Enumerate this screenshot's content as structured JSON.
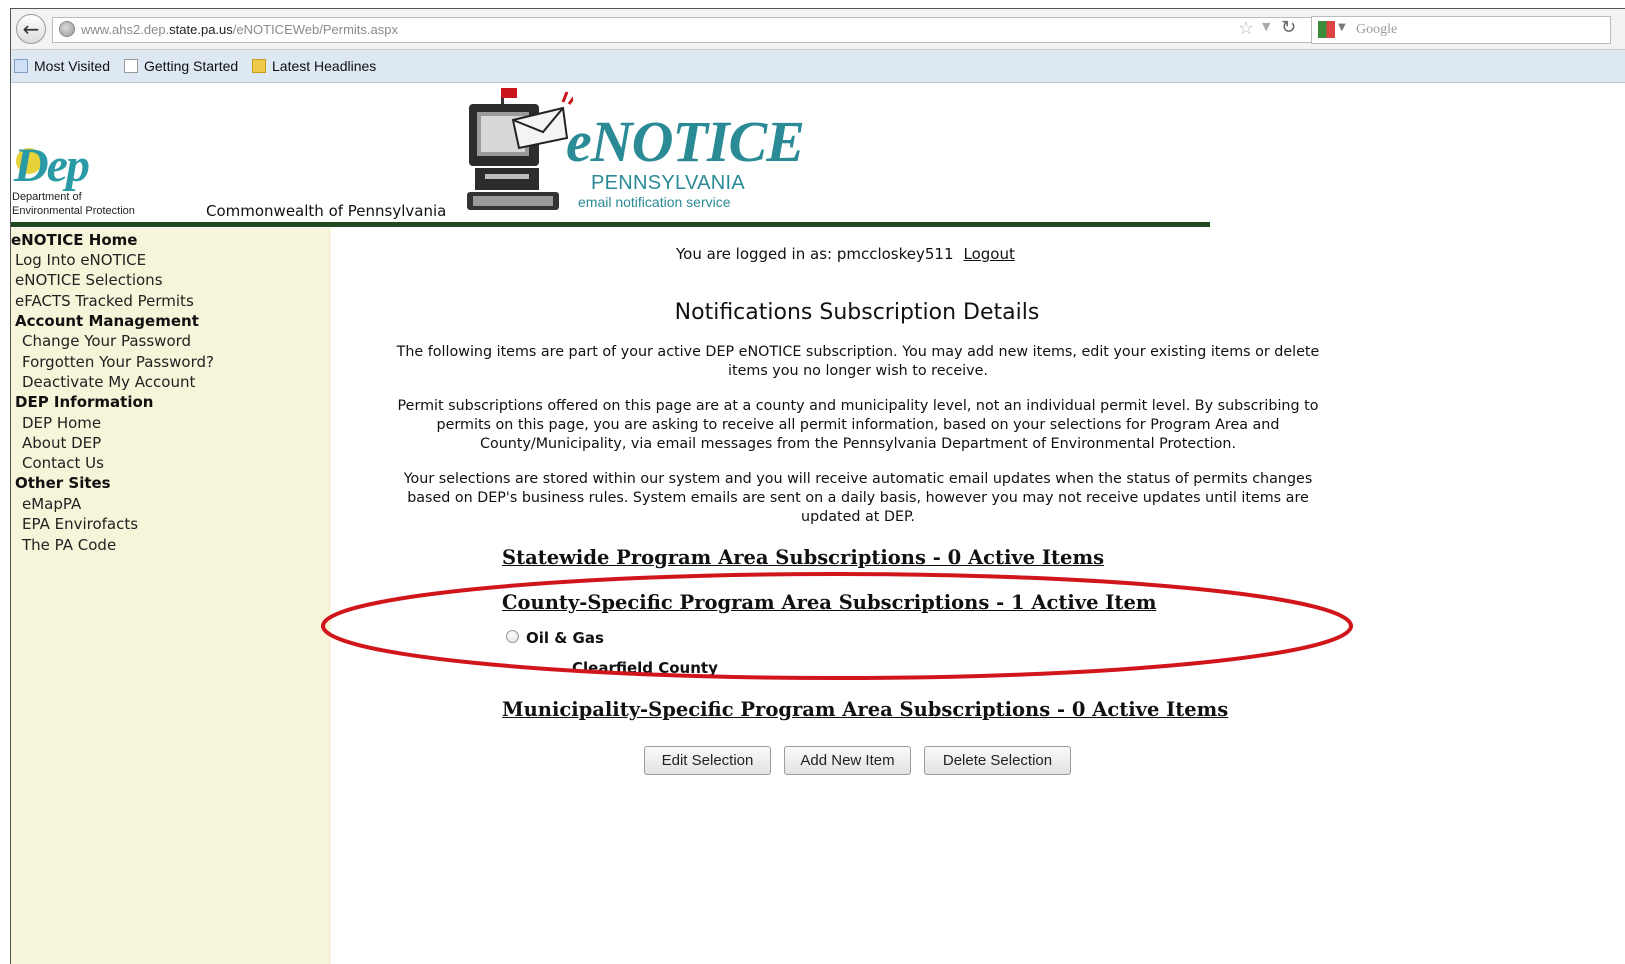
{
  "browser": {
    "url_prefix": "www.ahs2.dep.",
    "url_host": "state.pa.us",
    "url_path": "/eNOTICEWeb/Permits.aspx",
    "search_placeholder": "Google",
    "bookmarks": [
      "Most Visited",
      "Getting Started",
      "Latest Headlines"
    ]
  },
  "header": {
    "dep_logo_text": "Dep",
    "dep_sub_line1": "Department of",
    "dep_sub_line2": "Environmental Protection",
    "commonwealth": "Commonwealth of Pennsylvania",
    "enotice_title": "eNOTICE",
    "enotice_state": "PENNSYLVANIA",
    "enotice_tagline": "email notification service"
  },
  "sidebar": {
    "items": [
      {
        "label": "eNOTICE Home",
        "heading": true
      },
      {
        "label": "Log Into eNOTICE",
        "heading": false
      },
      {
        "label": "eNOTICE Selections",
        "heading": false
      },
      {
        "label": "eFACTS Tracked Permits",
        "heading": false
      },
      {
        "label": "Account Management",
        "heading": true
      },
      {
        "label": "Change Your Password",
        "heading": false
      },
      {
        "label": "Forgotten Your Password?",
        "heading": false
      },
      {
        "label": "Deactivate My Account",
        "heading": false
      },
      {
        "label": "DEP Information",
        "heading": true
      },
      {
        "label": "DEP Home",
        "heading": false
      },
      {
        "label": "About DEP",
        "heading": false
      },
      {
        "label": "Contact Us",
        "heading": false
      },
      {
        "label": "Other Sites",
        "heading": true
      },
      {
        "label": "eMapPA",
        "heading": false
      },
      {
        "label": "EPA Envirofacts",
        "heading": false
      },
      {
        "label": "The PA Code",
        "heading": false
      }
    ]
  },
  "main": {
    "logged_in_text": "You are logged in as: pmccloskey511",
    "logout_label": "Logout",
    "title": "Notifications Subscription Details",
    "para1_line1": "The following items are part of your active DEP eNOTICE subscription. You may add new items, edit your existing items or delete",
    "para1_line2": "items you no longer wish to receive.",
    "para2_line1": "Permit subscriptions offered on this page are at a county and municipality level, not an individual permit level. By subscribing to",
    "para2_line2": "permits on this page, you are asking to receive all permit information, based on your selections for Program Area and",
    "para2_line3": "County/Municipality, via email messages from the Pennsylvania Department of Environmental Protection.",
    "para3_line1": "Your selections are stored within our system and you will receive automatic email updates when the status of permits changes",
    "para3_line2": "based on DEP's business rules. System emails are sent on a daily basis, however you may not receive updates until items are",
    "para3_line3": "updated at DEP.",
    "statewide_heading": "Statewide Program Area Subscriptions - 0 Active Items",
    "county_heading": "County-Specific Program Area Subscriptions - 1 Active Item",
    "county_item_program": "Oil & Gas",
    "county_item_county": "Clearfield County",
    "municipality_heading": "Municipality-Specific Program Area Subscriptions - 0 Active Items",
    "buttons": {
      "edit": "Edit Selection",
      "add": "Add New Item",
      "delete": "Delete Selection"
    }
  },
  "colors": {
    "sidebar_bg": "#f6f4d9",
    "brand_teal": "#2a8a96",
    "header_rule": "#1f4a1f",
    "annotation_red": "#d0161b"
  }
}
